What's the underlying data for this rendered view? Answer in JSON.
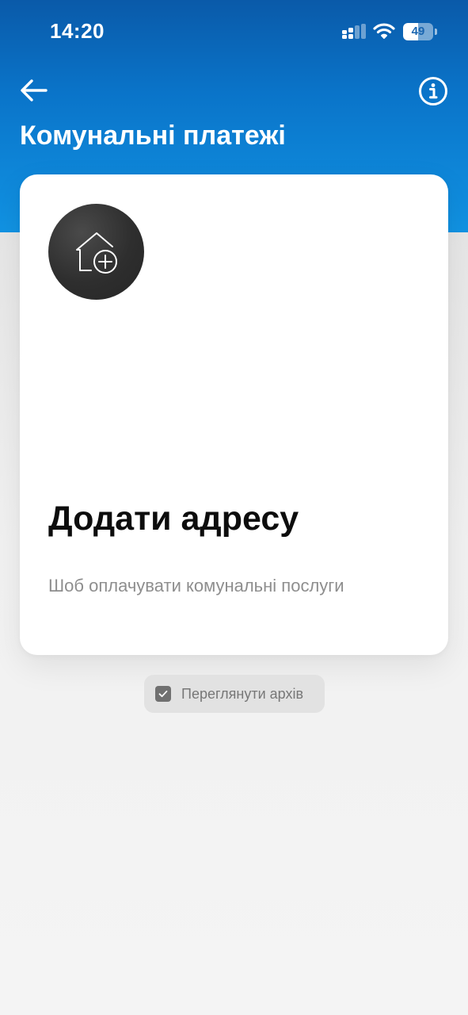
{
  "status_bar": {
    "time": "14:20",
    "battery_level": "49",
    "battery_fraction": 0.49,
    "signal_icon": "cellular-signal-icon",
    "wifi_icon": "wifi-icon",
    "battery_icon": "battery-icon"
  },
  "header": {
    "title": "Комунальні платежі",
    "back_icon": "arrow-left-icon",
    "info_icon": "info-icon"
  },
  "card": {
    "icon": "house-plus-icon",
    "title": "Додати адресу",
    "subtitle": "Шоб оплачувати комунальні послуги"
  },
  "archive_button": {
    "icon": "checkbox-checked-icon",
    "label": "Переглянути архів"
  },
  "colors": {
    "header_top": "#0a5aa9",
    "header_bottom": "#1193e3",
    "background": "#f3f3f3",
    "card": "#ffffff",
    "icon_circle": "#2e2e2e",
    "title_text": "#0d0d0d",
    "subtitle_text": "#8e8e8e",
    "archive_bg": "#e2e2e2"
  }
}
